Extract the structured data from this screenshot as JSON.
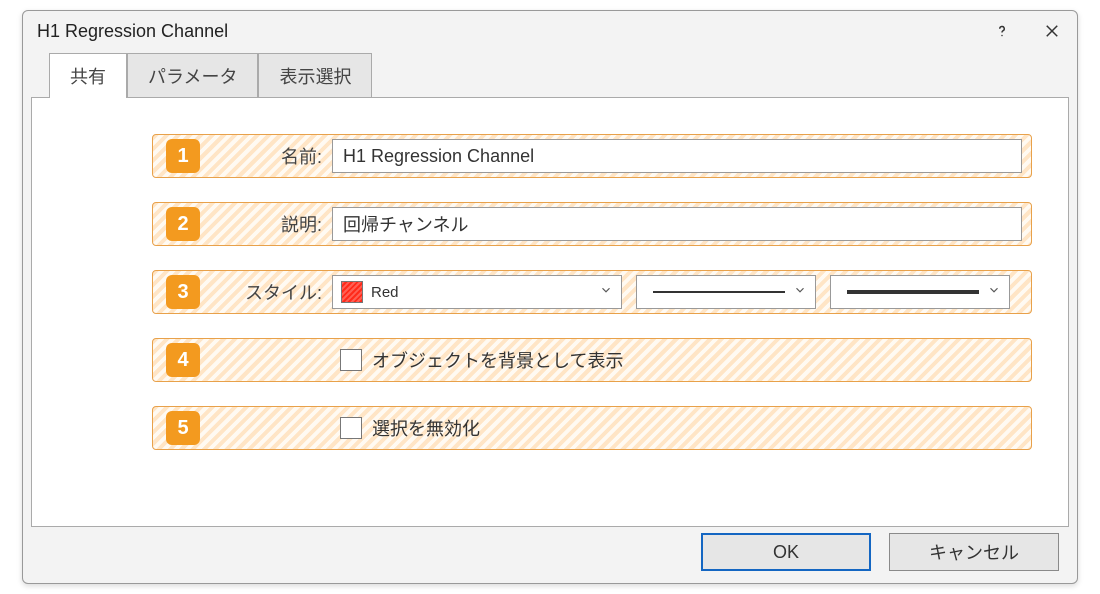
{
  "title": "H1 Regression Channel",
  "tabs": [
    "共有",
    "パラメータ",
    "表示選択"
  ],
  "activeTab": 0,
  "rows": {
    "name": {
      "label": "名前:",
      "value": "H1 Regression Channel"
    },
    "desc": {
      "label": "説明:",
      "value": "回帰チャンネル"
    },
    "style": {
      "label": "スタイル:",
      "colorName": "Red",
      "colorHex": "#ff2a1a"
    },
    "cb1": {
      "label": "オブジェクトを背景として表示",
      "checked": false
    },
    "cb2": {
      "label": "選択を無効化",
      "checked": false
    }
  },
  "buttons": {
    "ok": "OK",
    "cancel": "キャンセル"
  }
}
